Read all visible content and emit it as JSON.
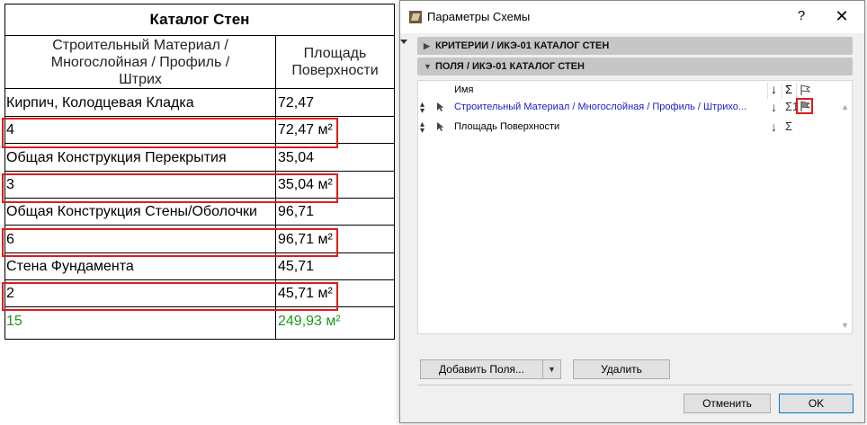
{
  "schedule": {
    "title": "Каталог Стен",
    "col1_header": "Строительный Материал / Многослойная / Профиль / Штрих",
    "col2_header": "Площадь Поверхности",
    "rows": [
      {
        "name": "Кирпич, Колодцевая Кладка",
        "area": "72,47"
      },
      {
        "name": "4",
        "area": "72,47 м²"
      },
      {
        "name": "Общая Конструкция Перекрытия",
        "area": "35,04"
      },
      {
        "name": "3",
        "area": "35,04 м²"
      },
      {
        "name": "Общая Конструкция Стены/Оболочки",
        "area": "96,71"
      },
      {
        "name": "6",
        "area": "96,71 м²"
      },
      {
        "name": "Стена Фундамента",
        "area": "45,71"
      },
      {
        "name": "2",
        "area": "45,71 м²"
      }
    ],
    "total": {
      "count": "15",
      "area": "249,93 м²"
    },
    "total_color": "#1a9a1a",
    "highlight_color": "#e01b1b"
  },
  "dialog": {
    "title": "Параметры Схемы",
    "help": "?",
    "close": "✕",
    "sections": {
      "criteria": "КРИТЕРИИ / ИКЭ-01 КАТАЛОГ СТЕН",
      "fields": "ПОЛЯ / ИКЭ-01 КАТАЛОГ СТЕН"
    },
    "panel": {
      "header_name": "Имя",
      "header_sort": "↓",
      "header_sum": "Σ",
      "fields": [
        {
          "name": "Строительный Материал / Многослойная / Профиль / Штрихо...",
          "sort": "↓",
          "sum": "Σ1",
          "selected": true
        },
        {
          "name": "Площадь Поверхности",
          "sort": "↓",
          "sum": "Σ",
          "selected": false
        }
      ],
      "link_color": "#1a1ac8"
    },
    "buttons": {
      "add_fields": "Добавить Поля...",
      "remove": "Удалить",
      "cancel": "Отменить",
      "ok": "OK"
    }
  }
}
